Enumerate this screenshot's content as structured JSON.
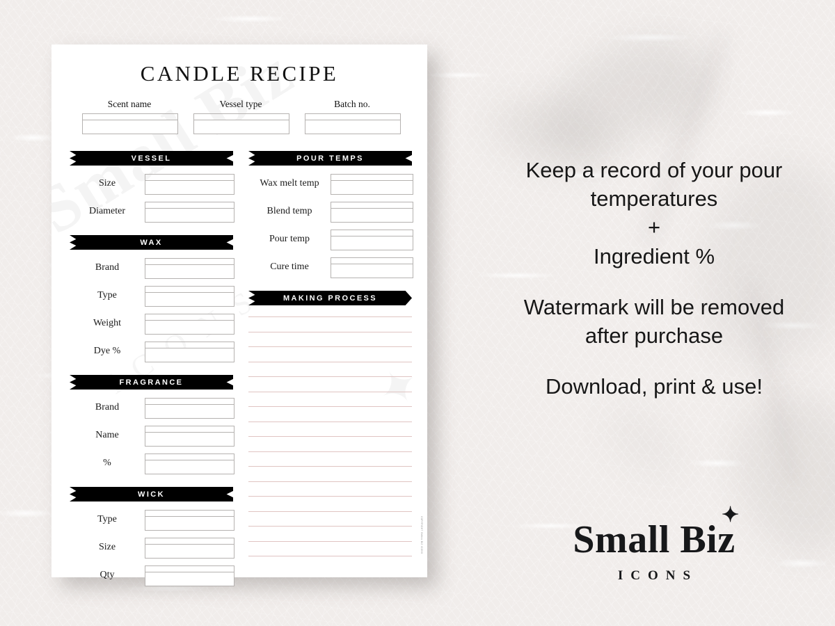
{
  "printable": {
    "title": "CANDLE RECIPE",
    "header_fields": [
      {
        "label": "Scent name",
        "value": ""
      },
      {
        "label": "Vessel type",
        "value": ""
      },
      {
        "label": "Batch no.",
        "value": ""
      }
    ],
    "left_column": [
      {
        "banner": "VESSEL",
        "fields": [
          {
            "label": "Size",
            "value": ""
          },
          {
            "label": "Diameter",
            "value": ""
          }
        ]
      },
      {
        "banner": "WAX",
        "fields": [
          {
            "label": "Brand",
            "value": ""
          },
          {
            "label": "Type",
            "value": ""
          },
          {
            "label": "Weight",
            "value": ""
          },
          {
            "label": "Dye %",
            "value": ""
          }
        ]
      },
      {
        "banner": "FRAGRANCE",
        "fields": [
          {
            "label": "Brand",
            "value": ""
          },
          {
            "label": "Name",
            "value": ""
          },
          {
            "label": "%",
            "value": ""
          }
        ]
      },
      {
        "banner": "WICK",
        "fields": [
          {
            "label": "Type",
            "value": ""
          },
          {
            "label": "Size",
            "value": ""
          },
          {
            "label": "Qty",
            "value": ""
          }
        ]
      }
    ],
    "right_column": [
      {
        "banner": "POUR TEMPS",
        "fields": [
          {
            "label": "Wax melt temp",
            "value": ""
          },
          {
            "label": "Blend temp",
            "value": ""
          },
          {
            "label": "Pour temp",
            "value": ""
          },
          {
            "label": "Cure time",
            "value": ""
          }
        ]
      }
    ],
    "making_process": {
      "banner": "MAKING PROCESS",
      "line_count": 17,
      "line_color": "#e0c4c2"
    },
    "watermark": {
      "main": "Small Biz",
      "sub": "ICONS",
      "star": "✦"
    },
    "micro_copyright": "COPYRIGHT SMALL BIZ ICONS"
  },
  "marketing": {
    "blocks": [
      "Keep a record of your pour temperatures\n+\nIngredient %",
      "Watermark will be removed after purchase",
      "Download, print & use!"
    ],
    "line1": "Keep a record of your pour",
    "line2": "temperatures",
    "line3": "+",
    "line4": "Ingredient %",
    "line5": "Watermark will be removed",
    "line6": "after purchase",
    "line7": "Download, print & use!"
  },
  "brand": {
    "wordmark": "Small Biz",
    "star": "✦",
    "subtitle": "ICONS"
  },
  "colors": {
    "background": "#f1edeb",
    "paper": "#ffffff",
    "banner": "#000000",
    "ink": "#171717",
    "rule": "#e0c4c2",
    "field_border": "#b5b2b0"
  }
}
